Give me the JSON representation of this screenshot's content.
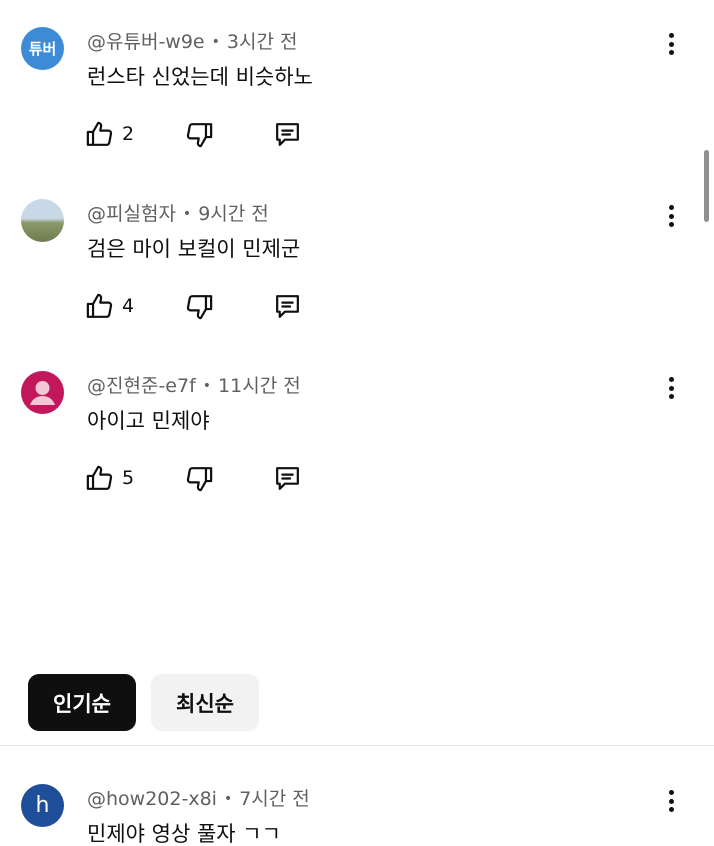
{
  "comments": [
    {
      "avatar_text": "튜버",
      "avatar_color": "#3d8bd6",
      "handle": "@유튜버-w9e",
      "time": "3시간 전",
      "text": "런스타 신었는데 비슷하노",
      "likes": "2"
    },
    {
      "avatar_text": "",
      "avatar_color": "#8a9a6a",
      "handle": "@피실험자",
      "time": "9시간 전",
      "text": "검은 마이 보컬이 민제군",
      "likes": "4"
    },
    {
      "avatar_text": "",
      "avatar_color": "#c2185b",
      "handle": "@진현준-e7f",
      "time": "11시간 전",
      "text": "아이고 민제야",
      "likes": "5"
    }
  ],
  "sort": {
    "popular": "인기순",
    "newest": "최신순"
  },
  "bottom_comment": {
    "avatar_text": "h",
    "avatar_color": "#1f4e9a",
    "handle": "@how202-x8i",
    "time": "7시간 전",
    "text": "민제야 영상 풀자 ㄱㄱ"
  },
  "separator": "•",
  "icons": [
    "like-icon",
    "dislike-icon",
    "reply-icon",
    "more-vert-icon"
  ]
}
